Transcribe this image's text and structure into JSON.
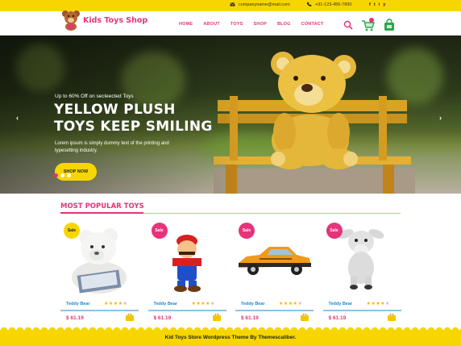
{
  "topbar": {
    "email": "companyname@mail.com",
    "phone": "+91-123-456-7890",
    "socials": [
      "f",
      "t",
      "i",
      "y"
    ]
  },
  "header": {
    "logo_text": "Kids Toys Shop",
    "nav": [
      "HOME",
      "ABOUT",
      "TOYS",
      "SHOP",
      "BLOG",
      "CONTACT"
    ],
    "icons": [
      "search-icon",
      "cart-icon",
      "bag-icon"
    ]
  },
  "hero": {
    "subtitle": "Up to 60% Off on secleected Toys",
    "title_line1": "YELLOW PLUSH",
    "title_line2": "TOYS KEEP SMILING",
    "description": "Lorem ipsum is simply dummy text of the printing and typesetting industry.",
    "button_label": "SHOP NOW",
    "prev_arrow": "‹",
    "next_arrow": "›",
    "slides": 3,
    "active_slide": 1
  },
  "section": {
    "title": "MOST POPULAR TOYS"
  },
  "products": [
    {
      "badge": "Sale",
      "badge_color": "yellow",
      "name": "Teddy Bear",
      "price": "$ 61.19",
      "rating": 4
    },
    {
      "badge": "Sale",
      "badge_color": "pink",
      "name": "Teddy Bear",
      "price": "$ 61.19",
      "rating": 4
    },
    {
      "badge": "Sale",
      "badge_color": "pink",
      "name": "Teddy Bear",
      "price": "$ 61.19",
      "rating": 4
    },
    {
      "badge": "Sale",
      "badge_color": "pink",
      "name": "Teddy Bear",
      "price": "$ 61.19",
      "rating": 4
    }
  ],
  "footer": {
    "text": "Kid Toys Store Wordpress Theme By Themescaliber."
  },
  "colors": {
    "accent_pink": "#e6337a",
    "accent_yellow": "#f7d600",
    "link_blue": "#1e88c8"
  }
}
